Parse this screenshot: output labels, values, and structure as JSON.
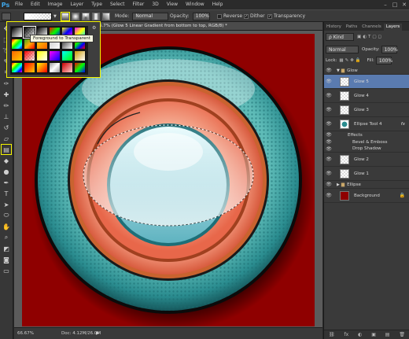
{
  "app": {
    "logo": "Ps"
  },
  "menu": [
    "File",
    "Edit",
    "Image",
    "Layer",
    "Type",
    "Select",
    "Filter",
    "3D",
    "View",
    "Window",
    "Help"
  ],
  "window_controls": [
    "–",
    "□",
    "✕"
  ],
  "options": {
    "mode_label": "Mode:",
    "mode_value": "Normal",
    "opacity_label": "Opacity:",
    "opacity_value": "100%",
    "reverse_label": "Reverse",
    "dither_label": "Dither",
    "transparency_label": "Transparency",
    "dither_checked": true,
    "transparency_checked": true
  },
  "document": {
    "tab_title": "d @ 66.7% (Glow 5      Linear Gradient from bottom to top, RGB/8) *"
  },
  "gradient_picker": {
    "tooltip": "Foreground to Transparent",
    "swatches": [
      "linear-gradient(135deg,#000,#fff)",
      "linear-gradient(135deg,#000,transparent)",
      "linear-gradient(135deg,#000,#fff)",
      "linear-gradient(135deg,#f00,#0f0,#00f)",
      "linear-gradient(135deg,#ff0,#00f,#f0f)",
      "linear-gradient(135deg,#f0f,#ff0,#0ff)",
      "linear-gradient(135deg,#f00,#ff0,#0f0,#0ff,#00f)",
      "linear-gradient(135deg,#3a2,#fa0,#f00)",
      "linear-gradient(135deg,#fc0,#f60)",
      "linear-gradient(135deg,#ccc,#fff)",
      "linear-gradient(135deg,#333,#fff)",
      "linear-gradient(135deg,#f00,#0f0,#00f,#f00)",
      "linear-gradient(135deg,#f60,#fc0)",
      "linear-gradient(135deg,#f00,transparent)",
      "linear-gradient(135deg,#ff0,#fff)",
      "linear-gradient(135deg,#f0f,#00f)",
      "linear-gradient(135deg,#0ff,#0f0)",
      "linear-gradient(135deg,#c90,#fff)",
      "linear-gradient(135deg,#f00,#ff0,#0f0,#0ff,#00f,#f0f)",
      "linear-gradient(135deg,#f00,#fc0)",
      "linear-gradient(135deg,#ff0,#f00)",
      "linear-gradient(135deg,#999,#fff,#999)",
      "linear-gradient(135deg,#c00,#fcc)",
      "linear-gradient(135deg,#f00,#0f0,#00f)"
    ]
  },
  "status": {
    "zoom": "66.67%",
    "doc_info": "Doc: 4.12M/26.0M"
  },
  "panel": {
    "tabs": [
      "History",
      "Paths",
      "Channels",
      "Layers"
    ],
    "active_tab": "Layers",
    "kind_label": "ρ Kind",
    "blend_mode": "Normal",
    "opacity_label": "Opacity:",
    "opacity_value": "100%",
    "lock_label": "Lock:",
    "fill_label": "Fill:",
    "fill_value": "100%",
    "fx_label": "fx",
    "effects_label": "Effects",
    "footer_icons": [
      "⛓",
      "fx",
      "◐",
      "▣",
      "▤",
      "🗑"
    ]
  },
  "layers": [
    {
      "name": "Glow",
      "type": "group"
    },
    {
      "name": "Glow 5",
      "type": "layer",
      "selected": true
    },
    {
      "name": "Glow 4",
      "type": "layer"
    },
    {
      "name": "Glow 3",
      "type": "layer"
    },
    {
      "name": "Ellipse Tool 4",
      "type": "ellipse",
      "fx": true
    },
    {
      "name": "Bevel & Emboss",
      "type": "effect"
    },
    {
      "name": "Drop Shadow",
      "type": "effect"
    },
    {
      "name": "Glow 2",
      "type": "layer"
    },
    {
      "name": "Glow 1",
      "type": "layer"
    },
    {
      "name": "Ellipse",
      "type": "group-collapsed"
    },
    {
      "name": "Background",
      "type": "background"
    }
  ],
  "colors": {
    "canvas": "#8f0000",
    "teal_ring": "#2a8c8f",
    "coral": "#ee7a5c",
    "glass": "#b6e6ee",
    "selection_highlight": "#5a7bb0",
    "tool_highlight": "#f5f500"
  }
}
